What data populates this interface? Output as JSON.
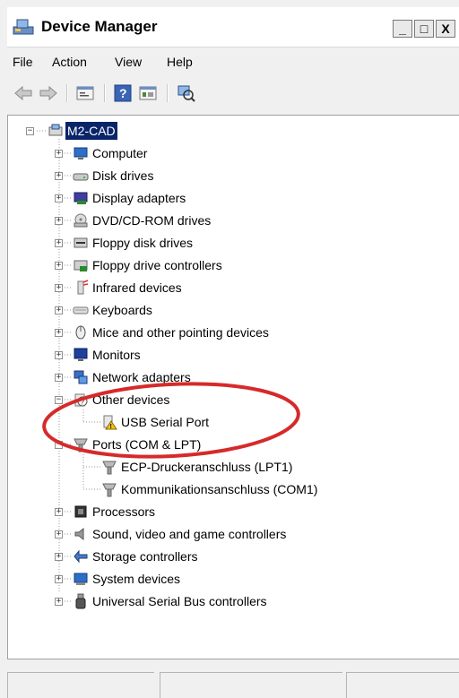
{
  "window": {
    "title": "Device Manager",
    "controls": [
      "_",
      "□",
      "X"
    ]
  },
  "menu": [
    "File",
    "Action",
    "View",
    "Help"
  ],
  "toolbar": [
    "back-icon",
    "forward-icon",
    "properties-icon",
    "help-icon",
    "update-driver-icon",
    "scan-hardware-icon"
  ],
  "tree": {
    "root": "M2-CAD",
    "categories": [
      {
        "label": "Computer",
        "icon": "computer-icon",
        "expanded": false
      },
      {
        "label": "Disk drives",
        "icon": "disk-drive-icon",
        "expanded": false
      },
      {
        "label": "Display adapters",
        "icon": "display-adapter-icon",
        "expanded": false
      },
      {
        "label": "DVD/CD-ROM drives",
        "icon": "dvd-drive-icon",
        "expanded": false
      },
      {
        "label": "Floppy disk drives",
        "icon": "floppy-drive-icon",
        "expanded": false
      },
      {
        "label": "Floppy drive controllers",
        "icon": "floppy-controller-icon",
        "expanded": false
      },
      {
        "label": "Infrared devices",
        "icon": "infrared-icon",
        "expanded": false
      },
      {
        "label": "Keyboards",
        "icon": "keyboard-icon",
        "expanded": false
      },
      {
        "label": "Mice and other pointing devices",
        "icon": "mouse-icon",
        "expanded": false
      },
      {
        "label": "Monitors",
        "icon": "monitor-icon",
        "expanded": false
      },
      {
        "label": "Network adapters",
        "icon": "network-icon",
        "expanded": false
      },
      {
        "label": "Other devices",
        "icon": "unknown-device-icon",
        "expanded": true,
        "children": [
          {
            "label": "USB Serial Port",
            "icon": "warning-device-icon"
          }
        ]
      },
      {
        "label": "Ports (COM & LPT)",
        "icon": "port-icon",
        "expanded": true,
        "children": [
          {
            "label": "ECP-Druckeranschluss (LPT1)",
            "icon": "port-icon"
          },
          {
            "label": "Kommunikationsanschluss (COM1)",
            "icon": "port-icon"
          }
        ]
      },
      {
        "label": "Processors",
        "icon": "processor-icon",
        "expanded": false
      },
      {
        "label": "Sound, video and game controllers",
        "icon": "sound-icon",
        "expanded": false
      },
      {
        "label": "Storage controllers",
        "icon": "storage-icon",
        "expanded": false
      },
      {
        "label": "System devices",
        "icon": "system-icon",
        "expanded": false
      },
      {
        "label": "Universal Serial Bus controllers",
        "icon": "usb-icon",
        "expanded": false
      }
    ]
  },
  "annotation_color": "#d62a2a"
}
